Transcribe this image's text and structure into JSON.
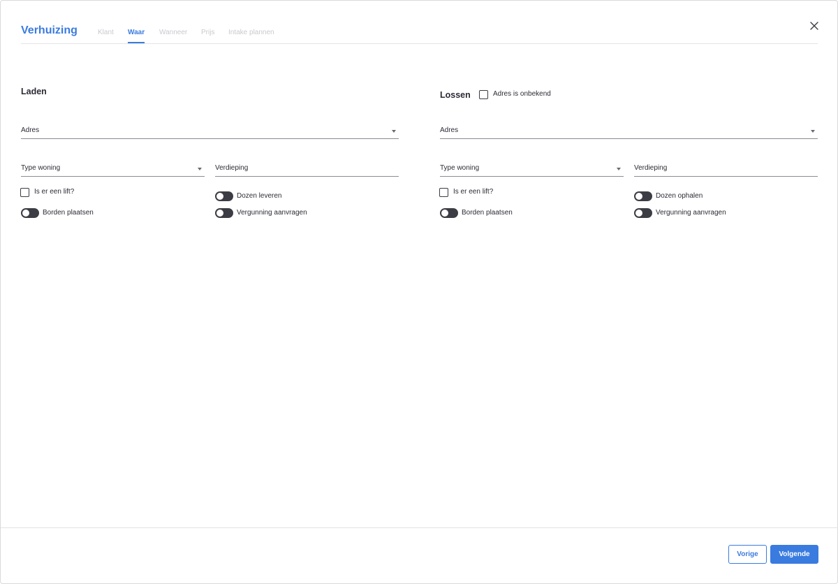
{
  "header": {
    "title": "Verhuizing",
    "tabs": [
      {
        "label": "Klant"
      },
      {
        "label": "Waar"
      },
      {
        "label": "Wanneer"
      },
      {
        "label": "Prijs"
      },
      {
        "label": "Intake plannen"
      }
    ],
    "active_tab": "Waar",
    "close_icon": "close-icon"
  },
  "laden": {
    "title": "Laden",
    "address_label": "Adres",
    "type_label": "Type woning",
    "floor_label": "Verdieping",
    "lift_label": "Is er een lift?",
    "boxes_label": "Dozen leveren",
    "signs_label": "Borden plaatsen",
    "permit_label": "Vergunning aanvragen"
  },
  "lossen": {
    "title": "Lossen",
    "unknown_label": "Adres is onbekend",
    "address_label": "Adres",
    "type_label": "Type woning",
    "floor_label": "Verdieping",
    "lift_label": "Is er een lift?",
    "boxes_label": "Dozen ophalen",
    "signs_label": "Borden plaatsen",
    "permit_label": "Vergunning aanvragen"
  },
  "footer": {
    "prev_label": "Vorige",
    "next_label": "Volgende"
  },
  "colors": {
    "accent": "#3a7be0",
    "toggle_off": "#3c3c45",
    "text": "#2b2b35"
  }
}
